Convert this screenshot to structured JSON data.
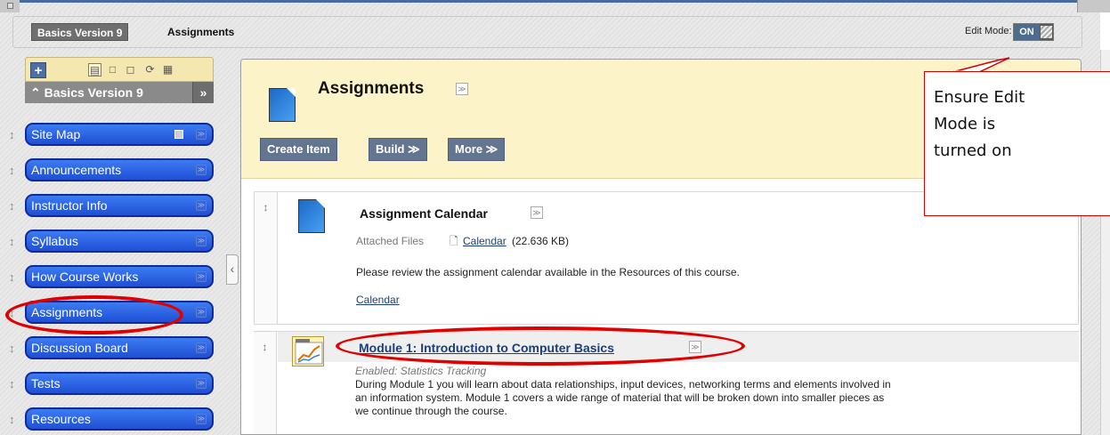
{
  "breadcrumb": {
    "course": "Basics Version 9",
    "page": "Assignments"
  },
  "edit_mode": {
    "label": "Edit Mode:",
    "state": "ON"
  },
  "course_menu": {
    "title": "Basics Version 9",
    "collapse_glyph": "»",
    "toolbar_icons": [
      "list-view-icon",
      "folder-view-icon",
      "window-icon",
      "refresh-icon",
      "grid-icon"
    ],
    "items": [
      {
        "label": "Site Map"
      },
      {
        "label": "Announcements"
      },
      {
        "label": "Instructor Info"
      },
      {
        "label": "Syllabus"
      },
      {
        "label": "How Course Works"
      },
      {
        "label": "Assignments"
      },
      {
        "label": "Discussion Board"
      },
      {
        "label": "Tests"
      },
      {
        "label": "Resources"
      }
    ]
  },
  "content": {
    "title": "Assignments",
    "buttons": {
      "create": "Create Item",
      "build": "Build ≫",
      "more": "More ≫"
    },
    "items": [
      {
        "title": "Assignment Calendar",
        "attached_label": "Attached Files",
        "attached_file": "Calendar",
        "attached_size": "(22.636 KB)",
        "description": "Please review the assignment calendar available in the Resources of this course.",
        "link": "Calendar"
      },
      {
        "title": "Module 1: Introduction to Computer Basics",
        "status": "Enabled: Statistics Tracking",
        "description_lines": [
          "During Module 1 you will learn about data relationships, input devices, networking terms and elements involved in",
          "an information system.  Module 1 covers a wide range of material that will be broken down into smaller pieces as",
          "we continue through the course."
        ]
      }
    ]
  },
  "annotation": {
    "callout_lines": [
      "Ensure Edit",
      "Mode is",
      "turned on"
    ],
    "color": "#e10000"
  },
  "colors": {
    "nav_blue": "#1f4fd6",
    "header_yellow": "#fdf3c8",
    "button_slate": "#63758f",
    "accent_red": "#e10000"
  }
}
